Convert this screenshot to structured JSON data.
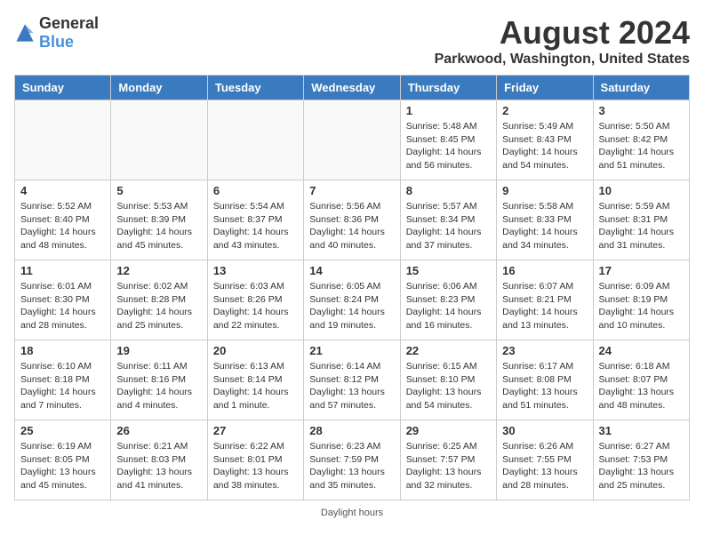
{
  "logo": {
    "general": "General",
    "blue": "Blue"
  },
  "title": "August 2024",
  "subtitle": "Parkwood, Washington, United States",
  "days_of_week": [
    "Sunday",
    "Monday",
    "Tuesday",
    "Wednesday",
    "Thursday",
    "Friday",
    "Saturday"
  ],
  "footer": "Daylight hours",
  "weeks": [
    [
      {
        "day": "",
        "info": ""
      },
      {
        "day": "",
        "info": ""
      },
      {
        "day": "",
        "info": ""
      },
      {
        "day": "",
        "info": ""
      },
      {
        "day": "1",
        "info": "Sunrise: 5:48 AM\nSunset: 8:45 PM\nDaylight: 14 hours\nand 56 minutes."
      },
      {
        "day": "2",
        "info": "Sunrise: 5:49 AM\nSunset: 8:43 PM\nDaylight: 14 hours\nand 54 minutes."
      },
      {
        "day": "3",
        "info": "Sunrise: 5:50 AM\nSunset: 8:42 PM\nDaylight: 14 hours\nand 51 minutes."
      }
    ],
    [
      {
        "day": "4",
        "info": "Sunrise: 5:52 AM\nSunset: 8:40 PM\nDaylight: 14 hours\nand 48 minutes."
      },
      {
        "day": "5",
        "info": "Sunrise: 5:53 AM\nSunset: 8:39 PM\nDaylight: 14 hours\nand 45 minutes."
      },
      {
        "day": "6",
        "info": "Sunrise: 5:54 AM\nSunset: 8:37 PM\nDaylight: 14 hours\nand 43 minutes."
      },
      {
        "day": "7",
        "info": "Sunrise: 5:56 AM\nSunset: 8:36 PM\nDaylight: 14 hours\nand 40 minutes."
      },
      {
        "day": "8",
        "info": "Sunrise: 5:57 AM\nSunset: 8:34 PM\nDaylight: 14 hours\nand 37 minutes."
      },
      {
        "day": "9",
        "info": "Sunrise: 5:58 AM\nSunset: 8:33 PM\nDaylight: 14 hours\nand 34 minutes."
      },
      {
        "day": "10",
        "info": "Sunrise: 5:59 AM\nSunset: 8:31 PM\nDaylight: 14 hours\nand 31 minutes."
      }
    ],
    [
      {
        "day": "11",
        "info": "Sunrise: 6:01 AM\nSunset: 8:30 PM\nDaylight: 14 hours\nand 28 minutes."
      },
      {
        "day": "12",
        "info": "Sunrise: 6:02 AM\nSunset: 8:28 PM\nDaylight: 14 hours\nand 25 minutes."
      },
      {
        "day": "13",
        "info": "Sunrise: 6:03 AM\nSunset: 8:26 PM\nDaylight: 14 hours\nand 22 minutes."
      },
      {
        "day": "14",
        "info": "Sunrise: 6:05 AM\nSunset: 8:24 PM\nDaylight: 14 hours\nand 19 minutes."
      },
      {
        "day": "15",
        "info": "Sunrise: 6:06 AM\nSunset: 8:23 PM\nDaylight: 14 hours\nand 16 minutes."
      },
      {
        "day": "16",
        "info": "Sunrise: 6:07 AM\nSunset: 8:21 PM\nDaylight: 14 hours\nand 13 minutes."
      },
      {
        "day": "17",
        "info": "Sunrise: 6:09 AM\nSunset: 8:19 PM\nDaylight: 14 hours\nand 10 minutes."
      }
    ],
    [
      {
        "day": "18",
        "info": "Sunrise: 6:10 AM\nSunset: 8:18 PM\nDaylight: 14 hours\nand 7 minutes."
      },
      {
        "day": "19",
        "info": "Sunrise: 6:11 AM\nSunset: 8:16 PM\nDaylight: 14 hours\nand 4 minutes."
      },
      {
        "day": "20",
        "info": "Sunrise: 6:13 AM\nSunset: 8:14 PM\nDaylight: 14 hours\nand 1 minute."
      },
      {
        "day": "21",
        "info": "Sunrise: 6:14 AM\nSunset: 8:12 PM\nDaylight: 13 hours\nand 57 minutes."
      },
      {
        "day": "22",
        "info": "Sunrise: 6:15 AM\nSunset: 8:10 PM\nDaylight: 13 hours\nand 54 minutes."
      },
      {
        "day": "23",
        "info": "Sunrise: 6:17 AM\nSunset: 8:08 PM\nDaylight: 13 hours\nand 51 minutes."
      },
      {
        "day": "24",
        "info": "Sunrise: 6:18 AM\nSunset: 8:07 PM\nDaylight: 13 hours\nand 48 minutes."
      }
    ],
    [
      {
        "day": "25",
        "info": "Sunrise: 6:19 AM\nSunset: 8:05 PM\nDaylight: 13 hours\nand 45 minutes."
      },
      {
        "day": "26",
        "info": "Sunrise: 6:21 AM\nSunset: 8:03 PM\nDaylight: 13 hours\nand 41 minutes."
      },
      {
        "day": "27",
        "info": "Sunrise: 6:22 AM\nSunset: 8:01 PM\nDaylight: 13 hours\nand 38 minutes."
      },
      {
        "day": "28",
        "info": "Sunrise: 6:23 AM\nSunset: 7:59 PM\nDaylight: 13 hours\nand 35 minutes."
      },
      {
        "day": "29",
        "info": "Sunrise: 6:25 AM\nSunset: 7:57 PM\nDaylight: 13 hours\nand 32 minutes."
      },
      {
        "day": "30",
        "info": "Sunrise: 6:26 AM\nSunset: 7:55 PM\nDaylight: 13 hours\nand 28 minutes."
      },
      {
        "day": "31",
        "info": "Sunrise: 6:27 AM\nSunset: 7:53 PM\nDaylight: 13 hours\nand 25 minutes."
      }
    ]
  ]
}
